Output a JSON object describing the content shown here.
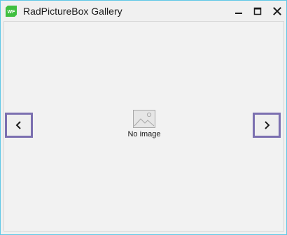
{
  "window": {
    "title": "RadPictureBox Gallery",
    "app_icon_text": "WF"
  },
  "titlebar_buttons": {
    "minimize_icon": "minimize-icon",
    "maximize_icon": "maximize-icon",
    "close_icon": "close-icon"
  },
  "gallery": {
    "empty_text": "No image",
    "empty_icon": "image-placeholder-icon",
    "prev_icon": "chevron-left-icon",
    "next_icon": "chevron-right-icon"
  },
  "colors": {
    "accent_border": "#7b6fb0",
    "window_border": "#5fc8e6",
    "app_icon_green": "#3fbf3f"
  }
}
